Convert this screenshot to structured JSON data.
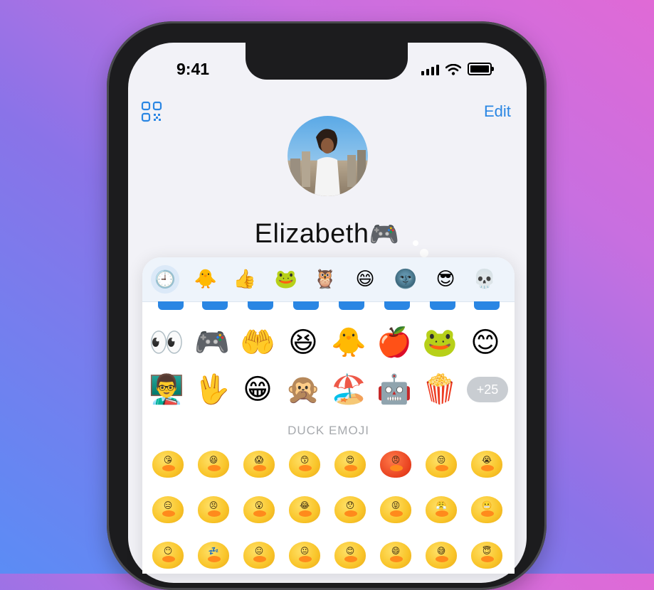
{
  "status_bar": {
    "time": "9:41"
  },
  "header": {
    "edit_label": "Edit",
    "qr_icon": "qr-code-icon"
  },
  "profile": {
    "name": "Elizabeth",
    "name_emoji": "🎮"
  },
  "emoji_panel": {
    "categories": [
      {
        "name": "recent",
        "glyph": "🕘"
      },
      {
        "name": "duck",
        "glyph": "🐥"
      },
      {
        "name": "gestures",
        "glyph": "👍"
      },
      {
        "name": "frog",
        "glyph": "🐸"
      },
      {
        "name": "owl",
        "glyph": "🦉"
      },
      {
        "name": "smile",
        "glyph": "😄"
      },
      {
        "name": "moon",
        "glyph": "🌚"
      },
      {
        "name": "cool",
        "glyph": "😎"
      },
      {
        "name": "skull",
        "glyph": "💀"
      }
    ],
    "recent_row1": [
      "👀",
      "🎮",
      "🤲",
      "😆",
      "🐥",
      "🍎",
      "🐸",
      "😊"
    ],
    "recent_row2": [
      "👨‍🏫",
      "🖖",
      "😁",
      "🙊",
      "🏖️",
      "🤖",
      "🍿"
    ],
    "more_count": "+25",
    "section_title": "DUCK EMOJI",
    "duck_row1": [
      "😘",
      "😆",
      "😱",
      "😙",
      "😍",
      "😠",
      "😒",
      "😭"
    ],
    "duck_row2": [
      "😑",
      "😣",
      "😮",
      "😂",
      "😯",
      "😝",
      "😤",
      "😬"
    ],
    "duck_row3": [
      "😶",
      "💤",
      "😐",
      "😐",
      "😊",
      "😄",
      "😅",
      "😇"
    ]
  }
}
